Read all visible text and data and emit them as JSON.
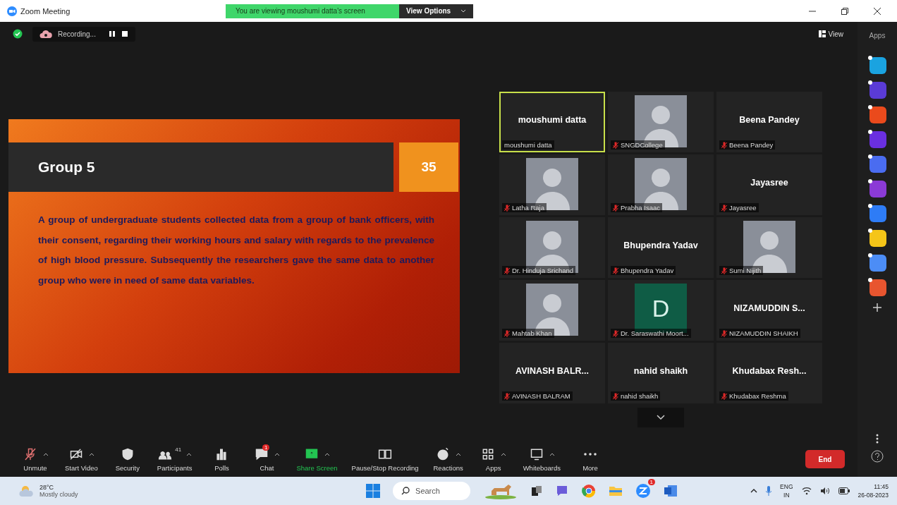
{
  "window": {
    "title": "Zoom Meeting"
  },
  "share_banner": {
    "text": "You are viewing moushumi datta's screen",
    "button": "View Options"
  },
  "recording": {
    "label": "Recording..."
  },
  "view_button": "View",
  "apps_label": "Apps",
  "slide": {
    "title": "Group 5",
    "number": "35",
    "body": "A group of undergraduate students collected data from a group of bank officers, with their consent, regarding their working hours and salary with regards to the prevalence of high blood pressure. Subsequently the researchers gave the same data to another group who were in need of same data variables."
  },
  "participants": [
    {
      "kind": "name",
      "name": "moushumi datta",
      "label": "moushumi datta",
      "muted": false,
      "active": true
    },
    {
      "kind": "photo",
      "label": "SNGDCollege",
      "muted": true,
      "active": false
    },
    {
      "kind": "name",
      "name": "Beena Pandey",
      "label": "Beena Pandey",
      "muted": true,
      "active": false
    },
    {
      "kind": "photo",
      "label": "Latha Raja",
      "muted": true,
      "active": false
    },
    {
      "kind": "photo",
      "label": "Prabha Isaac",
      "muted": true,
      "active": false
    },
    {
      "kind": "name",
      "name": "Jayasree",
      "label": "Jayasree",
      "muted": true,
      "active": false
    },
    {
      "kind": "photo",
      "label": "Dr. Hinduja Srichand",
      "muted": true,
      "active": false
    },
    {
      "kind": "name",
      "name": "Bhupendra Yadav",
      "label": "Bhupendra Yadav",
      "muted": true,
      "active": false
    },
    {
      "kind": "photo",
      "label": "Sumi Nijith",
      "muted": true,
      "active": false
    },
    {
      "kind": "photo",
      "label": "Mahtab Khan",
      "muted": true,
      "active": false
    },
    {
      "kind": "initial",
      "name": "D",
      "label": "Dr. Saraswathi Moort...",
      "muted": true,
      "active": false
    },
    {
      "kind": "name",
      "name": "NIZAMUDDIN S...",
      "label": "NIZAMUDDIN SHAIKH",
      "muted": true,
      "active": false
    },
    {
      "kind": "name",
      "name": "AVINASH BALR...",
      "label": "AVINASH BALRAM",
      "muted": true,
      "active": false
    },
    {
      "kind": "name",
      "name": "nahid shaikh",
      "label": "nahid shaikh",
      "muted": true,
      "active": false
    },
    {
      "kind": "name",
      "name": "Khudabax Resh...",
      "label": "Khudabax Reshma",
      "muted": true,
      "active": false
    }
  ],
  "toolbar": [
    {
      "kind": "mic-off",
      "label": "Unmute",
      "caret": true
    },
    {
      "kind": "video-off",
      "label": "Start Video",
      "caret": true
    },
    {
      "kind": "shield",
      "label": "Security",
      "caret": false
    },
    {
      "kind": "people",
      "label": "Participants",
      "caret": true,
      "count": "41"
    },
    {
      "kind": "poll",
      "label": "Polls",
      "caret": false
    },
    {
      "kind": "chat",
      "label": "Chat",
      "caret": true,
      "badge": "1"
    },
    {
      "kind": "share",
      "label": "Share Screen",
      "caret": true
    },
    {
      "kind": "record",
      "label": "Pause/Stop Recording",
      "caret": false
    },
    {
      "kind": "reaction",
      "label": "Reactions",
      "caret": true
    },
    {
      "kind": "apps",
      "label": "Apps",
      "caret": true
    },
    {
      "kind": "whiteboard",
      "label": "Whiteboards",
      "caret": true
    },
    {
      "kind": "more",
      "label": "More",
      "caret": false
    }
  ],
  "end_button": "End",
  "side_apps": [
    {
      "color": "#1aa3e0"
    },
    {
      "color": "#5a3bd6"
    },
    {
      "color": "#ea4a1c"
    },
    {
      "color": "#6a2fe0"
    },
    {
      "color": "#4a6cf0"
    },
    {
      "color": "#8b3ad6"
    },
    {
      "color": "#2e7cf6"
    },
    {
      "color": "#f5c518"
    },
    {
      "color": "#4c8df6"
    },
    {
      "color": "#e8552f"
    }
  ],
  "taskbar": {
    "temperature": "28°C",
    "weather": "Mostly cloudy",
    "search": "Search",
    "zoom_badge": "1",
    "lang": "ENG",
    "region": "IN",
    "time": "11:45",
    "date": "26-08-2023"
  }
}
